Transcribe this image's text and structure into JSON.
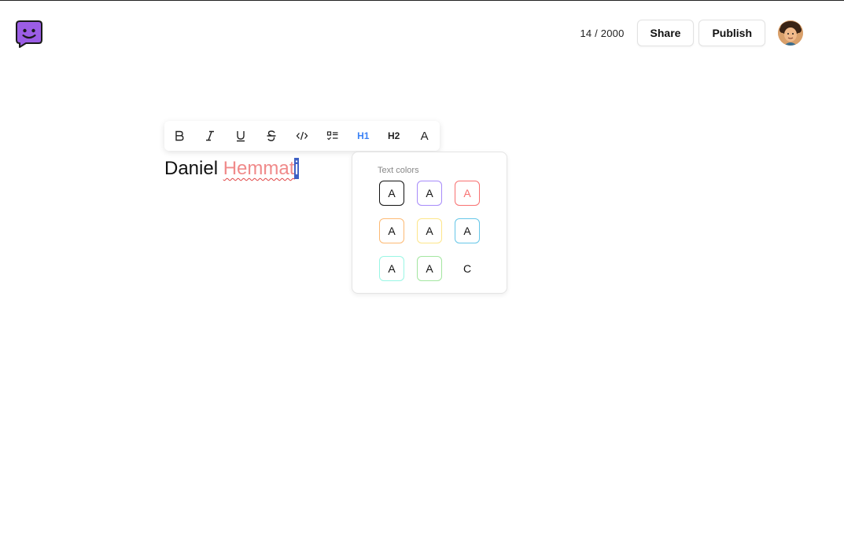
{
  "header": {
    "counter": "14 / 2000",
    "share_label": "Share",
    "publish_label": "Publish"
  },
  "toolbar": {
    "h1_label": "H1",
    "h2_label": "H2",
    "text_color_label": "A",
    "active_color": "#3b82f6"
  },
  "editor": {
    "text_plain": "Daniel ",
    "text_colored": "Hemmat",
    "text_selected": "i",
    "text_colored_color": "#f08a8a"
  },
  "color_popup": {
    "title": "Text colors",
    "swatches": [
      {
        "label": "A",
        "border": "#111111",
        "text": "#111111"
      },
      {
        "label": "A",
        "border": "#a78bfa",
        "text": "#111111"
      },
      {
        "label": "A",
        "border": "#f87171",
        "text": "#f87171"
      },
      {
        "label": "A",
        "border": "#fdba74",
        "text": "#111111"
      },
      {
        "label": "A",
        "border": "#fde68a",
        "text": "#111111"
      },
      {
        "label": "A",
        "border": "#67c7e8",
        "text": "#111111"
      },
      {
        "label": "A",
        "border": "#99f6e4",
        "text": "#111111"
      },
      {
        "label": "A",
        "border": "#a3e6a0",
        "text": "#111111"
      },
      {
        "label": "C",
        "border": "none",
        "text": "#111111"
      }
    ]
  },
  "colors": {
    "logo_purple": "#9b5de5",
    "selection": "#3d5fc4"
  }
}
